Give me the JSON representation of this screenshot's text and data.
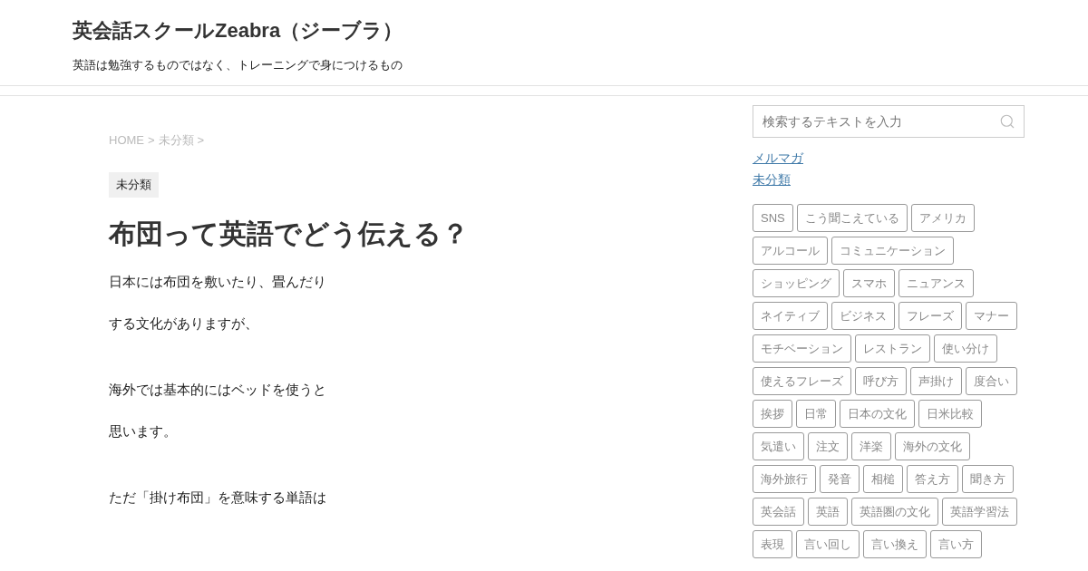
{
  "site": {
    "title": "英会話スクールZeabra（ジーブラ）",
    "tagline": "英語は勉強するものではなく、トレーニングで身につけるもの"
  },
  "breadcrumb": {
    "items": [
      "HOME",
      "未分類"
    ],
    "separator": ">"
  },
  "post": {
    "category": "未分類",
    "title": "布団って英語でどう伝える？",
    "body": [
      [
        "日本には布団を敷いたり、畳んだり",
        "する文化がありますが、"
      ],
      [
        "海外では基本的にはベッドを使うと",
        "思います。"
      ],
      [
        "ただ「掛け布団」を意味する単語は"
      ]
    ]
  },
  "sidebar": {
    "search": {
      "placeholder": "検索するテキストを入力"
    },
    "links": [
      "メルマガ",
      "未分類"
    ],
    "tags": [
      "SNS",
      "こう聞こえている",
      "アメリカ",
      "アルコール",
      "コミュニケーション",
      "ショッピング",
      "スマホ",
      "ニュアンス",
      "ネイティブ",
      "ビジネス",
      "フレーズ",
      "マナー",
      "モチベーション",
      "レストラン",
      "使い分け",
      "使えるフレーズ",
      "呼び方",
      "声掛け",
      "度合い",
      "挨拶",
      "日常",
      "日本の文化",
      "日米比較",
      "気遣い",
      "注文",
      "洋楽",
      "海外の文化",
      "海外旅行",
      "発音",
      "相槌",
      "答え方",
      "聞き方",
      "英会話",
      "英語",
      "英語圏の文化",
      "英語学習法",
      "表現",
      "言い回し",
      "言い換え",
      "言い方"
    ]
  }
}
